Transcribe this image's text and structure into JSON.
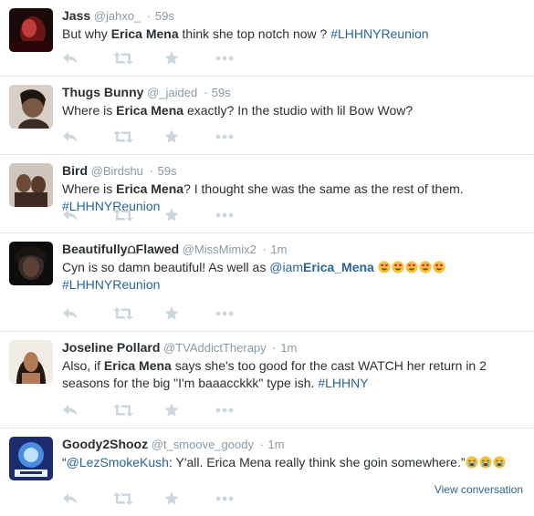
{
  "tweets": [
    {
      "name": "Jass",
      "username": "@jahxo_",
      "dot": "·",
      "time": "59s",
      "parts": [
        {
          "t": "But why "
        },
        {
          "b": "Erica Mena"
        },
        {
          "t": " think she top notch now ? "
        },
        {
          "h": "#LHHNYReunion"
        }
      ]
    },
    {
      "name": "Thugs Bunny",
      "username": "@_jaided",
      "dot": "·",
      "time": "59s",
      "parts": [
        {
          "t": "Where is "
        },
        {
          "b": "Erica Mena"
        },
        {
          "t": " exactly? In the studio with lil Bow Wow?"
        }
      ]
    },
    {
      "name": "Bird",
      "username": "@Birdshu",
      "dot": "·",
      "time": "59s",
      "parts": [
        {
          "t": "Where is "
        },
        {
          "b": "Erica Mena"
        },
        {
          "t": "? I thought she was the same as the rest of them."
        },
        {
          "br": true
        },
        {
          "h": "#LHHNYReunion"
        }
      ]
    },
    {
      "name": "Beautifully⩍Flawed",
      "username": "@MissMimix2",
      "dot": "·",
      "time": "1m",
      "parts": [
        {
          "t": "Cyn is so damn beautiful! As well as "
        },
        {
          "m": "@iam",
          "mb": "Erica_Mena"
        },
        {
          "t": " "
        },
        {
          "e": "heart-eyes",
          "n": 5
        },
        {
          "br": true
        },
        {
          "h": "#LHHNYReunion"
        }
      ]
    },
    {
      "name": "Joseline Pollard",
      "username": "@TVAddictTherapy",
      "dot": "·",
      "time": "1m",
      "parts": [
        {
          "t": "Also, if "
        },
        {
          "b": "Erica Mena"
        },
        {
          "t": " says she's too good for the cast WATCH her return in 2 seasons for the big \"I'm baaacckkk\" type ish. "
        },
        {
          "h": "#LHHNY"
        }
      ]
    },
    {
      "name": "Goody2Shooz",
      "username": "@t_smoove_goody",
      "dot": "·",
      "time": "1m",
      "parts": [
        {
          "t": "“"
        },
        {
          "m": "@LezSmokeKush"
        },
        {
          "t": ": Y'all. Erica Mena really think she goin somewhere.”"
        },
        {
          "e": "crying",
          "n": 3
        }
      ],
      "view_conversation": "View conversation"
    }
  ],
  "colors": {
    "link": "#2a6496",
    "meta": "#8899a6",
    "action_icon": "#ccd6dd",
    "divider": "#e1e8ed"
  },
  "action_icons": [
    "reply-icon",
    "retweet-icon",
    "favorite-icon",
    "more-icon"
  ]
}
